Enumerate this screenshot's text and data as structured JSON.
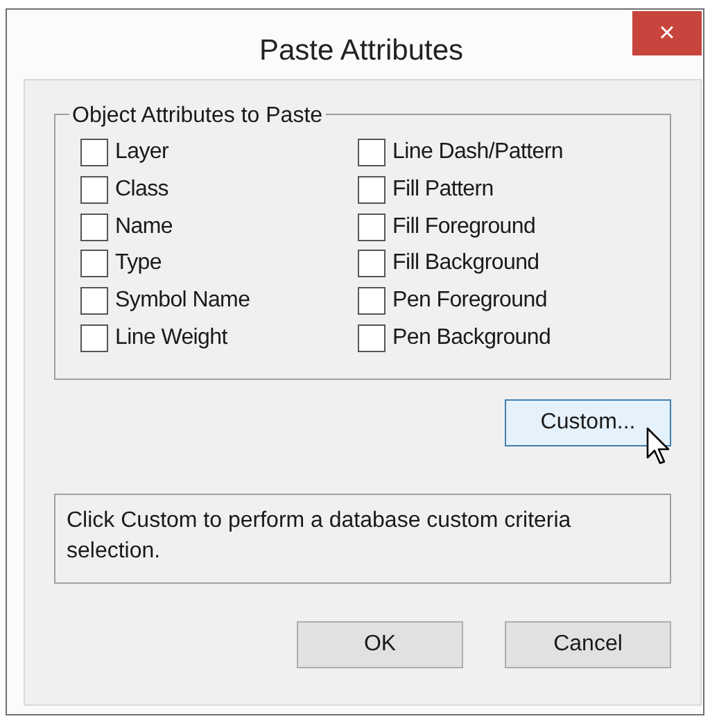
{
  "window": {
    "title": "Paste Attributes",
    "close": "×"
  },
  "group": {
    "title": "Object Attributes to Paste",
    "columns": [
      [
        {
          "label": "Layer",
          "checked": false
        },
        {
          "label": "Class",
          "checked": false
        },
        {
          "label": "Name",
          "checked": false
        },
        {
          "label": "Type",
          "checked": false
        },
        {
          "label": "Symbol Name",
          "checked": false
        },
        {
          "label": "Line Weight",
          "checked": false
        }
      ],
      [
        {
          "label": "Line Dash/Pattern",
          "checked": false
        },
        {
          "label": "Fill Pattern",
          "checked": false
        },
        {
          "label": "Fill Foreground",
          "checked": false
        },
        {
          "label": "Fill Background",
          "checked": false
        },
        {
          "label": "Pen Foreground",
          "checked": false
        },
        {
          "label": "Pen Background",
          "checked": false
        }
      ]
    ]
  },
  "custom_button": {
    "label": "Custom...",
    "hovered": true
  },
  "info": "Click Custom to perform a database custom criteria selection.",
  "buttons": [
    {
      "label": "OK",
      "hovered": false
    },
    {
      "label": "Cancel",
      "hovered": false
    }
  ]
}
